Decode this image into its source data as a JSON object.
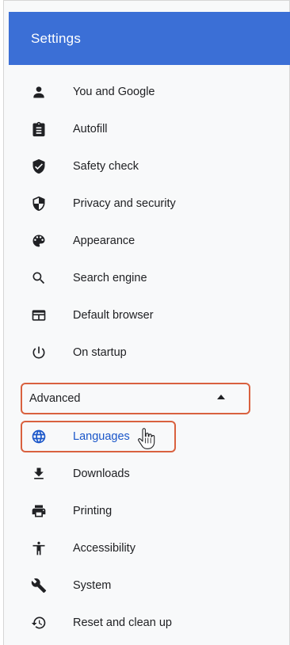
{
  "header": {
    "title": "Settings"
  },
  "nav": {
    "items": [
      {
        "label": "You and Google",
        "icon": "person-icon"
      },
      {
        "label": "Autofill",
        "icon": "clipboard-icon"
      },
      {
        "label": "Safety check",
        "icon": "shield-check-icon"
      },
      {
        "label": "Privacy and security",
        "icon": "shield-half-icon"
      },
      {
        "label": "Appearance",
        "icon": "palette-icon"
      },
      {
        "label": "Search engine",
        "icon": "search-icon"
      },
      {
        "label": "Default browser",
        "icon": "browser-window-icon"
      },
      {
        "label": "On startup",
        "icon": "power-icon"
      }
    ],
    "advanced": {
      "label": "Advanced",
      "expanded": true
    },
    "advanced_items": [
      {
        "label": "Languages",
        "icon": "globe-icon",
        "active": true
      },
      {
        "label": "Downloads",
        "icon": "download-icon"
      },
      {
        "label": "Printing",
        "icon": "printer-icon"
      },
      {
        "label": "Accessibility",
        "icon": "accessibility-icon"
      },
      {
        "label": "System",
        "icon": "wrench-icon"
      },
      {
        "label": "Reset and clean up",
        "icon": "restore-icon"
      }
    ]
  },
  "colors": {
    "header": "#3b6fd6",
    "active": "#1a56c9",
    "annotation": "#d9613f"
  }
}
